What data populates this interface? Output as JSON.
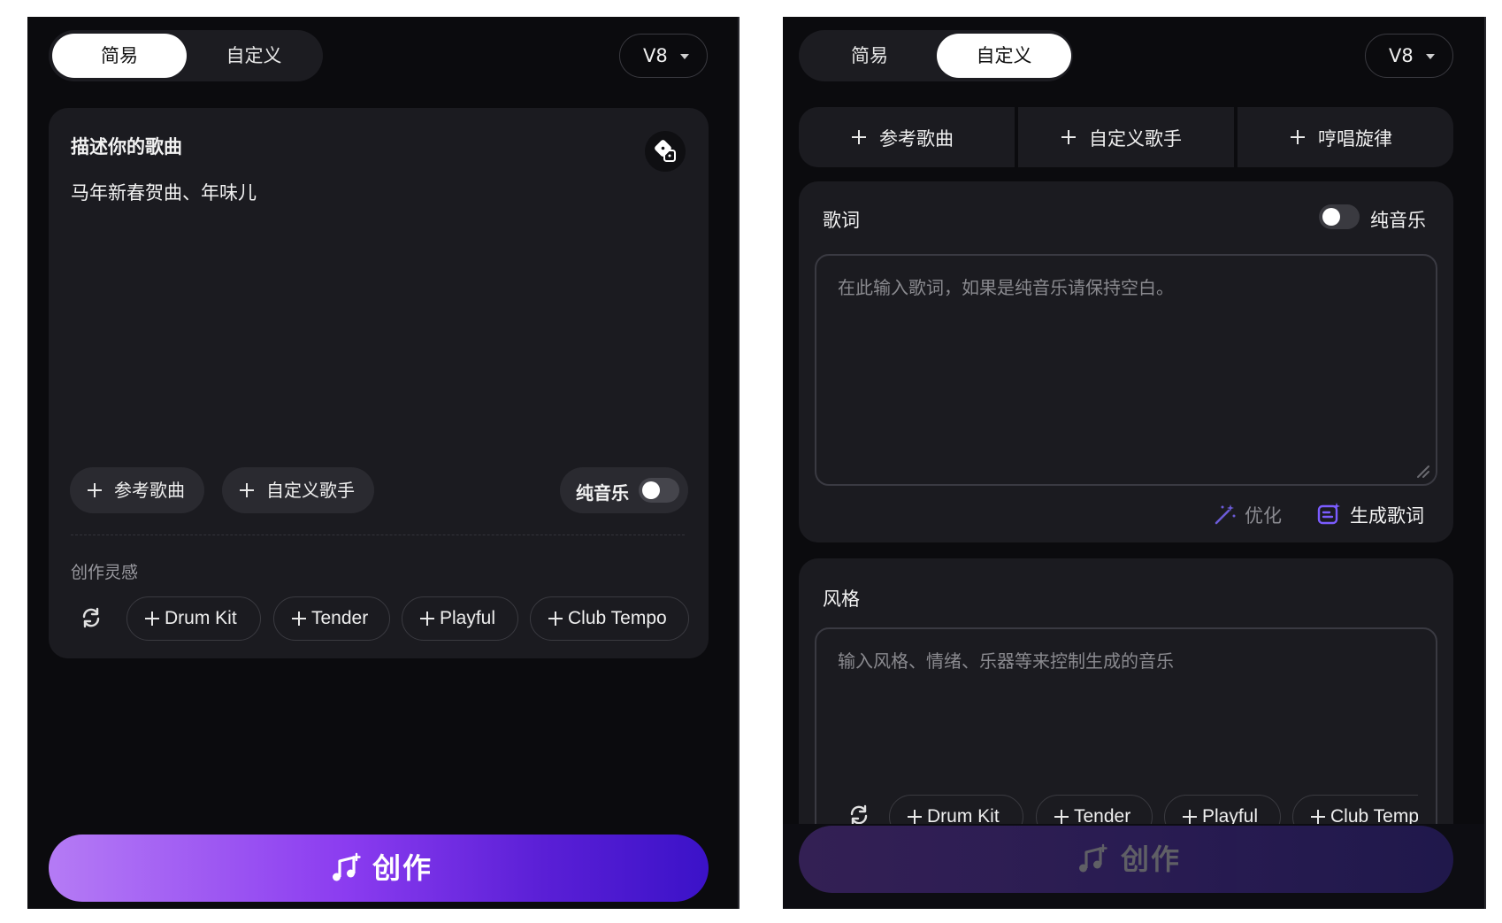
{
  "left_panel": {
    "mode_tabs": [
      "简易",
      "自定义"
    ],
    "active_tab": 0,
    "version": "V8",
    "describe": {
      "title": "描述你的歌曲",
      "value": "马年新春贺曲、年味儿",
      "dice_icon": "dice-icon"
    },
    "add_reference_label": "参考歌曲",
    "add_singer_label": "自定义歌手",
    "instrumental_label": "纯音乐",
    "instrumental_on": false,
    "inspiration_title": "创作灵感",
    "inspiration_tags": [
      "Drum Kit",
      "Tender",
      "Playful",
      "Club Tempo"
    ],
    "create_label": "创作",
    "create_gradient": [
      "#b57bf5",
      "#8b3cf0",
      "#5a1fd6",
      "#3b12c8"
    ]
  },
  "right_panel": {
    "mode_tabs": [
      "简易",
      "自定义"
    ],
    "active_tab": 1,
    "version": "V8",
    "top_actions": [
      "参考歌曲",
      "自定义歌手",
      "哼唱旋律"
    ],
    "lyrics": {
      "title": "歌词",
      "instrumental_label": "纯音乐",
      "instrumental_on": false,
      "placeholder": "在此输入歌词，如果是纯音乐请保持空白。",
      "optimize_label": "优化",
      "generate_label": "生成歌词"
    },
    "style": {
      "title": "风格",
      "placeholder": "输入风格、情绪、乐器等来控制生成的音乐",
      "tags": [
        "Drum Kit",
        "Tender",
        "Playful",
        "Club Tempo"
      ]
    },
    "create_label": "创作",
    "create_disabled": true
  },
  "accent_color": "#7b5cff"
}
